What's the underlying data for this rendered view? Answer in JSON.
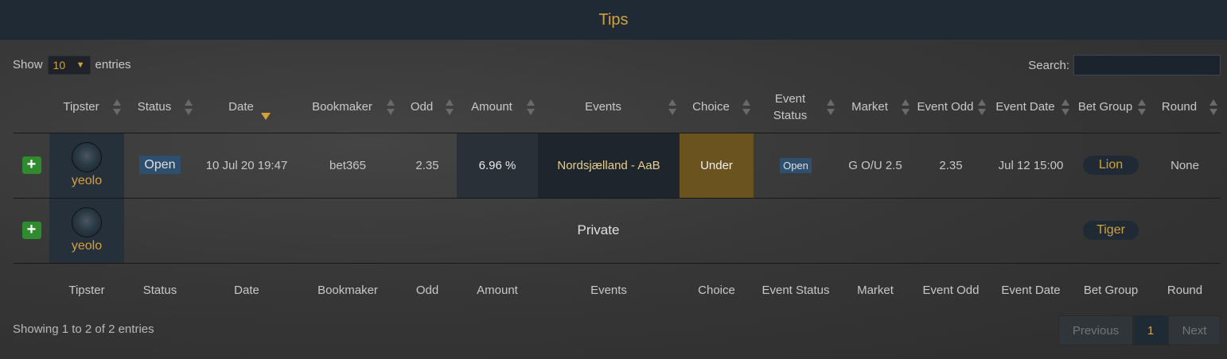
{
  "header": {
    "title": "Tips"
  },
  "controls": {
    "show_label": "Show",
    "length_value": "10",
    "entries_label": "entries",
    "search_label": "Search:",
    "search_value": ""
  },
  "columns": [
    "Tipster",
    "Status",
    "Date",
    "Bookmaker",
    "Odd",
    "Amount",
    "Events",
    "Choice",
    "Event Status",
    "Market",
    "Event Odd",
    "Event Date",
    "Bet Group",
    "Round"
  ],
  "rows": [
    {
      "tipster": "yeolo",
      "status": "Open",
      "date": "10 Jul 20 19:47",
      "bookmaker": "bet365",
      "odd": "2.35",
      "amount": "6.96 %",
      "events": "Nordsjælland - AaB",
      "choice": "Under",
      "event_status": "Open",
      "market": "G O/U 2.5",
      "event_odd": "2.35",
      "event_date": "Jul 12 15:00",
      "bet_group": "Lion",
      "round": "None"
    },
    {
      "tipster": "yeolo",
      "private_text": "Private",
      "bet_group": "Tiger"
    }
  ],
  "footer": {
    "info": "Showing 1 to 2 of 2 entries",
    "previous": "Previous",
    "page": "1",
    "next": "Next"
  },
  "colors": {
    "accent": "#d4a23a",
    "header_bg": "#1f2a34",
    "expand_green": "#2e8b2e",
    "badge_blue": "#2e4f6e",
    "choice_bg": "#6a531f"
  }
}
